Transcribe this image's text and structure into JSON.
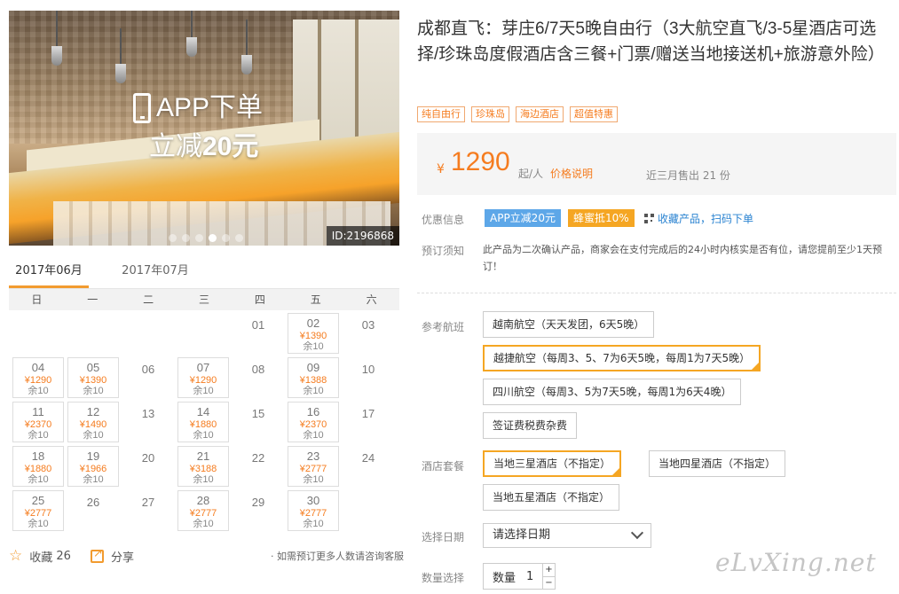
{
  "hero": {
    "promo_line1": "APP下单",
    "promo_line2_prefix": "立减",
    "promo_line2_amount": "20元",
    "id_tag": "ID:2196868",
    "slide_count": 6,
    "active_slide": 4
  },
  "calendar": {
    "months": [
      "2017年06月",
      "2017年07月"
    ],
    "active_month": "2017年06月",
    "weekdays": [
      "日",
      "一",
      "二",
      "三",
      "四",
      "五",
      "六"
    ],
    "remaining_label": "余10",
    "days": [
      {
        "day": "",
        "price": "",
        "left": ""
      },
      {
        "day": "",
        "price": "",
        "left": ""
      },
      {
        "day": "",
        "price": "",
        "left": ""
      },
      {
        "day": "",
        "price": "",
        "left": ""
      },
      {
        "day": "01",
        "price": "",
        "left": ""
      },
      {
        "day": "02",
        "price": "¥1390",
        "left": "余10"
      },
      {
        "day": "03",
        "price": "",
        "left": ""
      },
      {
        "day": "04",
        "price": "¥1290",
        "left": "余10"
      },
      {
        "day": "05",
        "price": "¥1390",
        "left": "余10"
      },
      {
        "day": "06",
        "price": "",
        "left": ""
      },
      {
        "day": "07",
        "price": "¥1290",
        "left": "余10"
      },
      {
        "day": "08",
        "price": "",
        "left": ""
      },
      {
        "day": "09",
        "price": "¥1388",
        "left": "余10"
      },
      {
        "day": "10",
        "price": "",
        "left": ""
      },
      {
        "day": "11",
        "price": "¥2370",
        "left": "余10"
      },
      {
        "day": "12",
        "price": "¥1490",
        "left": "余10"
      },
      {
        "day": "13",
        "price": "",
        "left": ""
      },
      {
        "day": "14",
        "price": "¥1880",
        "left": "余10"
      },
      {
        "day": "15",
        "price": "",
        "left": ""
      },
      {
        "day": "16",
        "price": "¥2370",
        "left": "余10"
      },
      {
        "day": "17",
        "price": "",
        "left": ""
      },
      {
        "day": "18",
        "price": "¥1880",
        "left": "余10"
      },
      {
        "day": "19",
        "price": "¥1966",
        "left": "余10"
      },
      {
        "day": "20",
        "price": "",
        "left": ""
      },
      {
        "day": "21",
        "price": "¥3188",
        "left": "余10"
      },
      {
        "day": "22",
        "price": "",
        "left": ""
      },
      {
        "day": "23",
        "price": "¥2777",
        "left": "余10"
      },
      {
        "day": "24",
        "price": "",
        "left": ""
      },
      {
        "day": "25",
        "price": "¥2777",
        "left": "余10"
      },
      {
        "day": "26",
        "price": "",
        "left": ""
      },
      {
        "day": "27",
        "price": "",
        "left": ""
      },
      {
        "day": "28",
        "price": "¥2777",
        "left": "余10"
      },
      {
        "day": "29",
        "price": "",
        "left": ""
      },
      {
        "day": "30",
        "price": "¥2777",
        "left": "余10"
      }
    ]
  },
  "actions": {
    "favorite_label": "收藏",
    "favorite_count": "26",
    "share_label": "分享",
    "hint": "· 如需预订更多人数请咨询客服"
  },
  "product": {
    "title": "成都直飞：芽庄6/7天5晚自由行（3大航空直飞/3-5星酒店可选择/珍珠岛度假酒店含三餐+门票/赠送当地接送机+旅游意外险）",
    "tags": [
      "纯自由行",
      "珍珠岛",
      "海边酒店",
      "超值特惠"
    ],
    "currency": "¥",
    "price": "1290",
    "price_unit": "起/人",
    "price_explain": "价格说明",
    "sold": "近三月售出 21 份"
  },
  "offers": {
    "label": "优惠信息",
    "badge_app": "APP立减20元",
    "badge_honey": "蜂蜜抵10%",
    "qr_link": "收藏产品，扫码下单"
  },
  "notice": {
    "label": "预订须知",
    "text": "此产品为二次确认产品，商家会在支付完成后的24小时内核实是否有位，请您提前至少1天预订！"
  },
  "flights": {
    "label": "参考航班",
    "options": [
      "越南航空（天天发团，6天5晚）",
      "越捷航空（每周3、5、7为6天5晚，每周1为7天5晚）",
      "四川航空（每周3、5为7天5晚，每周1为6天4晚）",
      "签证费税费杂费"
    ],
    "selected": 1
  },
  "hotels": {
    "label": "酒店套餐",
    "options": [
      "当地三星酒店（不指定）",
      "当地四星酒店（不指定）",
      "当地五星酒店（不指定）"
    ],
    "selected": 0
  },
  "date_select": {
    "label": "选择日期",
    "placeholder": "请选择日期"
  },
  "quantity": {
    "label": "数量选择",
    "field_label": "数量",
    "value": "1",
    "plus": "+",
    "minus": "−"
  },
  "watermark": "eLvXing.net",
  "colors": {
    "accent": "#f57c1f",
    "tab_underline": "#f29b2f",
    "selected_border": "#f5a623",
    "badge_blue": "#5da7e8",
    "badge_orange": "#f5a623",
    "link": "#2a83d1"
  }
}
